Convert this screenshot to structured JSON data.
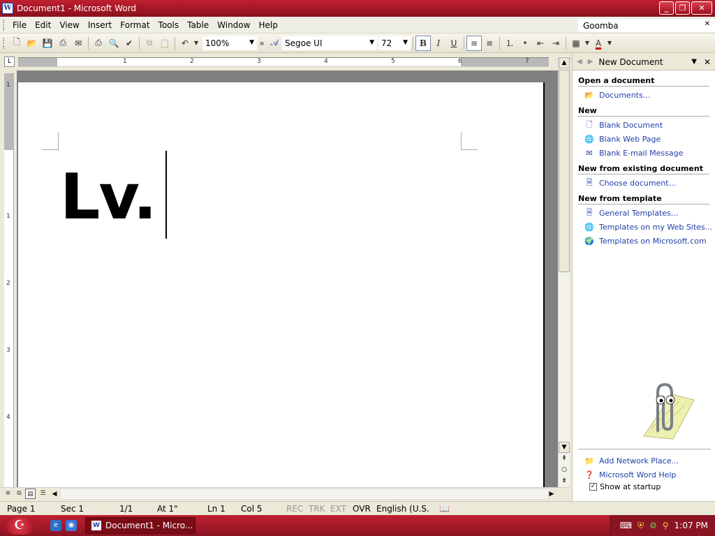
{
  "window": {
    "title": "Document1 - Microsoft Word"
  },
  "menu": {
    "items": [
      "File",
      "Edit",
      "View",
      "Insert",
      "Format",
      "Tools",
      "Table",
      "Window",
      "Help"
    ],
    "help_box_value": "Goomba"
  },
  "toolbar": {
    "zoom": "100%",
    "font": "Segoe UI",
    "font_size": "72"
  },
  "ruler": {
    "h_numbers": [
      "1",
      "2",
      "3",
      "4",
      "5",
      "6",
      "7"
    ],
    "v_numbers": [
      "1",
      "1",
      "2",
      "3",
      "4"
    ]
  },
  "document": {
    "text": "Lv."
  },
  "taskpane": {
    "title": "New Document",
    "sections": {
      "open": "Open a document",
      "new": "New",
      "existing": "New from existing document",
      "template": "New from template"
    },
    "links": {
      "documents": "Documents...",
      "blank_document": "Blank Document",
      "blank_web_page": "Blank Web Page",
      "blank_email": "Blank E-mail Message",
      "choose_document": "Choose document...",
      "general_templates": "General Templates...",
      "templates_web_sites": "Templates on my Web Sites...",
      "templates_microsoft": "Templates on Microsoft.com",
      "add_network_place": "Add Network Place...",
      "word_help": "Microsoft Word Help",
      "show_at_startup": "Show at startup"
    }
  },
  "status": {
    "page": "Page 1",
    "sec": "Sec 1",
    "pages": "1/1",
    "at": "At 1\"",
    "ln": "Ln 1",
    "col": "Col 5",
    "rec": "REC",
    "trk": "TRK",
    "ext": "EXT",
    "ovr": "OVR",
    "language": "English (U.S."
  },
  "taskbar": {
    "task_label": "Document1 - Micro...",
    "clock": "1:07 PM"
  },
  "colors": {
    "title_bar": "#b01a28",
    "link": "#1f3fa8",
    "taskbar": "#9a1624"
  }
}
